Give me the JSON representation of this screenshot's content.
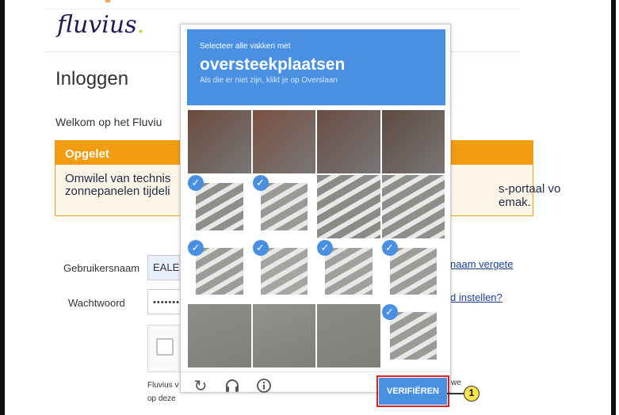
{
  "site": {
    "logo_text": "fluvius",
    "logo_dot": "."
  },
  "login": {
    "title": "Inloggen",
    "welcome": "Welkom op het Fluviu",
    "alert": {
      "heading": "Opgelet",
      "line1_start": "Omwilel van technis",
      "line2_start": "zonnepanelen tijdeli",
      "line1_end": "s-portaal vo",
      "line2_end": "emak."
    },
    "username_label": "Gebruikersnaam",
    "username_value": "EALE",
    "password_label": "Wachtwoord",
    "password_value": "•••••••",
    "forgot_username": "naam vergete",
    "set_password": "d instellen?",
    "disclaimer_line1": "Fluvius v",
    "disclaimer_line2": "op deze",
    "disclaimer_end": "we"
  },
  "challenge": {
    "instruction_small": "Selecteer alle vakken met",
    "instruction_big": "oversteekplaatsen",
    "instruction_sub": "Als die er niet zijn, klikt je op Overslaan",
    "verify_label": "VERIFIËREN",
    "reload_icon": "reload-icon",
    "audio_icon": "headphones-icon",
    "info_icon": "info-icon",
    "selected_mark": "✓",
    "tiles": [
      {
        "r": 0,
        "c": 0,
        "selected": false,
        "color": "#6b4a3c"
      },
      {
        "r": 0,
        "c": 1,
        "selected": false,
        "color": "#7a5040"
      },
      {
        "r": 0,
        "c": 2,
        "selected": false,
        "color": "#6a4c44"
      },
      {
        "r": 0,
        "c": 3,
        "selected": false,
        "color": "#5f4a40"
      },
      {
        "r": 1,
        "c": 0,
        "selected": true,
        "color": "#8f8f8a"
      },
      {
        "r": 1,
        "c": 1,
        "selected": true,
        "color": "#9a9a95"
      },
      {
        "r": 1,
        "c": 2,
        "selected": false,
        "color": "#8a8a86"
      },
      {
        "r": 1,
        "c": 3,
        "selected": false,
        "color": "#8e8e8a"
      },
      {
        "r": 2,
        "c": 0,
        "selected": true,
        "color": "#9b9b98"
      },
      {
        "r": 2,
        "c": 1,
        "selected": true,
        "color": "#a4a4a0"
      },
      {
        "r": 2,
        "c": 2,
        "selected": true,
        "color": "#a0a09c"
      },
      {
        "r": 2,
        "c": 3,
        "selected": true,
        "color": "#9c9c98"
      },
      {
        "r": 3,
        "c": 0,
        "selected": false,
        "color": "#8d8d89"
      },
      {
        "r": 3,
        "c": 1,
        "selected": false,
        "color": "#92928e"
      },
      {
        "r": 3,
        "c": 2,
        "selected": false,
        "color": "#8a8a86"
      },
      {
        "r": 3,
        "c": 3,
        "selected": true,
        "color": "#9a9a96"
      }
    ]
  },
  "annotation": {
    "callout_number": "1"
  }
}
